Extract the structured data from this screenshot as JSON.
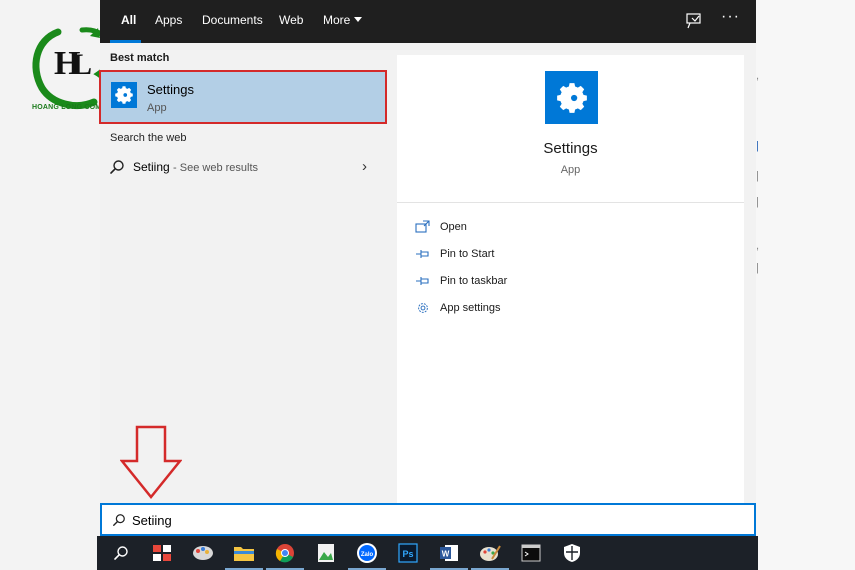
{
  "start_menu": {
    "tabs": [
      {
        "label": "All"
      },
      {
        "label": "Apps"
      },
      {
        "label": "Documents"
      },
      {
        "label": "Web"
      },
      {
        "label": "More"
      }
    ],
    "overflow_label": "···",
    "best_match": {
      "heading": "Best match",
      "title": "Settings",
      "subtitle": "App",
      "icon": "gear-icon"
    },
    "web_search": {
      "heading": "Search the web",
      "query": "Setiing",
      "suffix": "- See web results"
    },
    "preview": {
      "title": "Settings",
      "subtitle": "App",
      "actions": [
        {
          "label": "Open",
          "icon": "open-icon"
        },
        {
          "label": "Pin to Start",
          "icon": "pin-icon"
        },
        {
          "label": "Pin to taskbar",
          "icon": "pin-icon"
        },
        {
          "label": "App settings",
          "icon": "gear-icon"
        }
      ]
    }
  },
  "search_box": {
    "value": "Setiing"
  },
  "watermark": {
    "logo_text": "HOANG LONG COMPUTER"
  },
  "taskbar": {
    "items": [
      {
        "icon": "search-icon"
      },
      {
        "icon": "anydesk-icon"
      },
      {
        "icon": "paint-icon"
      },
      {
        "icon": "file-explorer-icon"
      },
      {
        "icon": "chrome-icon"
      },
      {
        "icon": "photos-icon"
      },
      {
        "icon": "zalo-icon",
        "label": "Zalo"
      },
      {
        "icon": "photoshop-icon",
        "label": "Ps"
      },
      {
        "icon": "word-icon",
        "label": "W"
      },
      {
        "icon": "paint-palette-icon"
      },
      {
        "icon": "terminal-icon"
      },
      {
        "icon": "security-shield-icon"
      }
    ]
  },
  "colors": {
    "accent": "#0078d7",
    "highlight": "#b3cfe6",
    "annotation_red": "#d42a2a",
    "topbar": "#1f1f1f",
    "taskbar": "#1c2128"
  }
}
